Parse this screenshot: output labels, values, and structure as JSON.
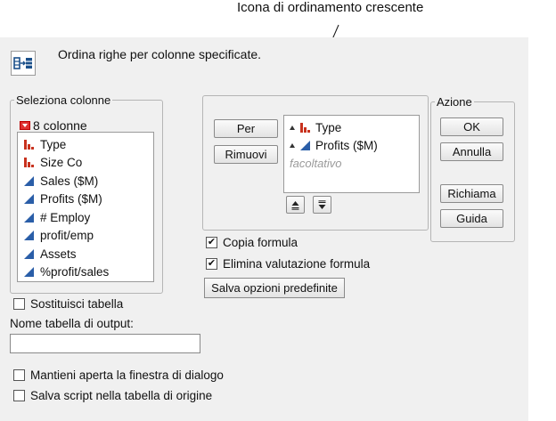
{
  "callout": {
    "text": "Icona di ordinamento crescente"
  },
  "header": {
    "description": "Ordina righe per colonne specificate."
  },
  "select_columns": {
    "title": "Seleziona colonne",
    "count_label": "8 colonne",
    "items": [
      {
        "label": "Type",
        "kind": "nominal"
      },
      {
        "label": "Size Co",
        "kind": "nominal"
      },
      {
        "label": "Sales ($M)",
        "kind": "continuous"
      },
      {
        "label": "Profits ($M)",
        "kind": "continuous"
      },
      {
        "label": "# Employ",
        "kind": "continuous"
      },
      {
        "label": "profit/emp",
        "kind": "continuous"
      },
      {
        "label": "Assets",
        "kind": "continuous"
      },
      {
        "label": "%profit/sales",
        "kind": "continuous"
      }
    ]
  },
  "sort": {
    "by_button": "Per",
    "remove_button": "Rimuovi",
    "items": [
      {
        "label": "Type",
        "kind": "nominal"
      },
      {
        "label": "Profits ($M)",
        "kind": "continuous"
      }
    ],
    "optional_placeholder": "facoltativo",
    "ascending_icon": "ascending-sort-icon",
    "descending_icon": "descending-sort-icon"
  },
  "options": {
    "copy_formula": {
      "label": "Copia formula",
      "checked": true
    },
    "suppress_eval": {
      "label": "Elimina valutazione formula",
      "checked": true
    },
    "save_defaults": "Salva opzioni predefinite"
  },
  "action": {
    "title": "Azione",
    "ok": "OK",
    "cancel": "Annulla",
    "recall": "Richiama",
    "help": "Guida"
  },
  "output": {
    "replace_table": {
      "label": "Sostituisci tabella",
      "checked": false
    },
    "output_name_label": "Nome tabella di output:",
    "output_name_value": "",
    "keep_open": {
      "label": "Mantieni aperta la finestra di dialogo",
      "checked": false
    },
    "save_script": {
      "label": "Salva script nella tabella di origine",
      "checked": false
    }
  },
  "colors": {
    "nominal": "#c8321e",
    "continuous": "#2a5ea8",
    "dialog_bg": "#f0f0f0"
  }
}
